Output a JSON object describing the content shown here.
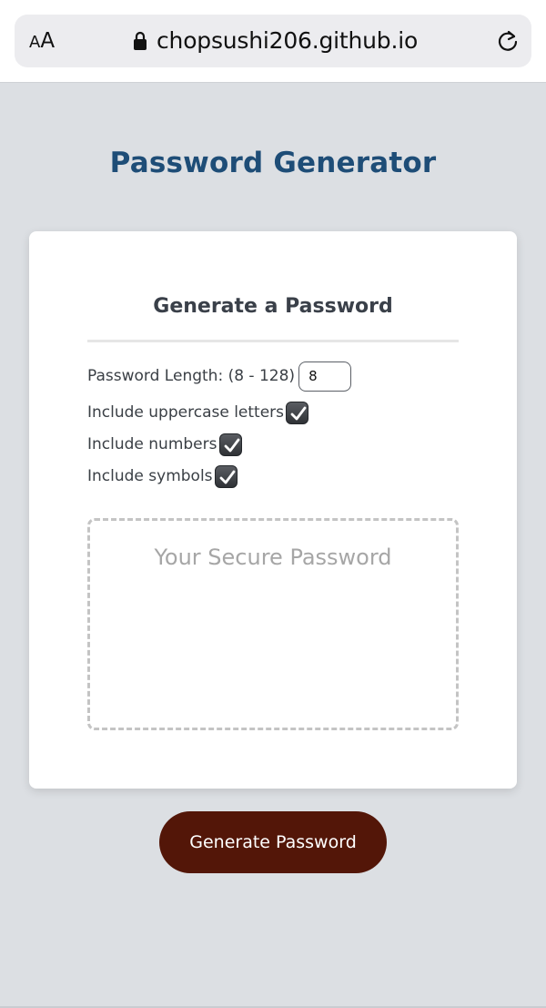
{
  "browser": {
    "text_size_small": "A",
    "text_size_big": "A",
    "url": "chopsushi206.github.io"
  },
  "page": {
    "title": "Password Generator"
  },
  "card": {
    "title": "Generate a Password",
    "length_label": "Password Length: (8 - 128)",
    "length_value": "8",
    "uppercase_label": "Include uppercase letters",
    "uppercase_checked": true,
    "numbers_label": "Include numbers",
    "numbers_checked": true,
    "symbols_label": "Include symbols",
    "symbols_checked": true,
    "password_placeholder": "Your Secure Password"
  },
  "actions": {
    "generate_label": "Generate Password"
  },
  "colors": {
    "title": "#1e4d77",
    "button": "#531608",
    "background": "#dcdfe3"
  }
}
